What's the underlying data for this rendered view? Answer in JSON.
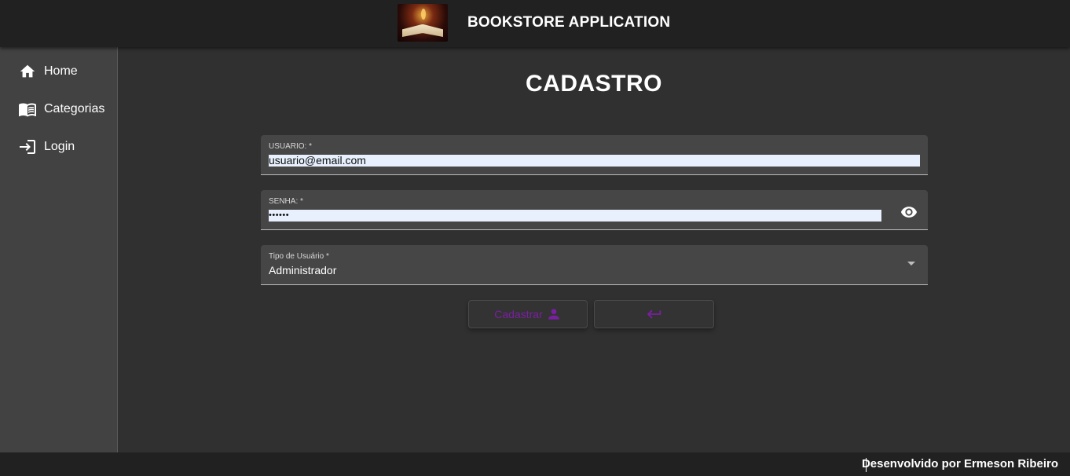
{
  "header": {
    "title": "BOOKSTORE APPLICATION",
    "logo_icon": "open-book-logo"
  },
  "sidebar": {
    "items": [
      {
        "label": "Home",
        "icon": "home-icon"
      },
      {
        "label": "Categorias",
        "icon": "menu-book-icon"
      },
      {
        "label": "Login",
        "icon": "login-icon"
      }
    ]
  },
  "main": {
    "title": "CADASTRO",
    "form": {
      "usuario": {
        "label": "USUARIO: *",
        "value": "usuario@email.com"
      },
      "senha": {
        "label": "SENHA: *",
        "value": "••••••",
        "toggle_icon": "visibility-icon"
      },
      "tipo": {
        "label": "Tipo de Usuário *",
        "value": "Administrador"
      }
    },
    "buttons": {
      "cadastrar_label": "Cadastrar",
      "cadastrar_icon": "person-icon",
      "back_icon": "keyboard-return-icon"
    }
  },
  "footer": {
    "text": "Desenvolvido por Ermeson Ribeiro"
  },
  "colors": {
    "topbar": "#212121",
    "sidebar": "#424242",
    "background": "#303030",
    "accent": "#7b1fa2",
    "autofill": "#e8f0fe"
  }
}
